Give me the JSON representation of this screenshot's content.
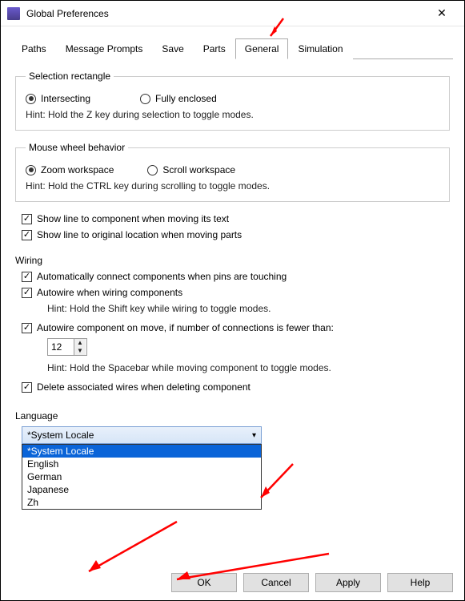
{
  "window": {
    "title": "Global Preferences"
  },
  "tabs": [
    "Paths",
    "Message Prompts",
    "Save",
    "Parts",
    "General",
    "Simulation"
  ],
  "active_tab": 4,
  "selection_rectangle": {
    "legend": "Selection rectangle",
    "opt1": "Intersecting",
    "opt2": "Fully enclosed",
    "selected": 0,
    "hint": "Hint: Hold the Z key during selection to toggle modes."
  },
  "mouse_wheel": {
    "legend": "Mouse wheel behavior",
    "opt1": "Zoom workspace",
    "opt2": "Scroll workspace",
    "selected": 0,
    "hint": "Hint: Hold the CTRL key during scrolling to toggle modes."
  },
  "checks": {
    "line_text": "Show line to component when moving its text",
    "line_text_checked": true,
    "line_loc": "Show line to original location when moving parts",
    "line_loc_checked": true
  },
  "wiring": {
    "legend": "Wiring",
    "auto_connect": "Automatically connect components when pins are touching",
    "auto_connect_checked": true,
    "autowire": "Autowire when wiring components",
    "autowire_checked": true,
    "autowire_hint": "Hint: Hold the Shift key while wiring to toggle modes.",
    "autowire_move": "Autowire component on move, if number of connections is fewer than:",
    "autowire_move_checked": true,
    "autowire_move_value": "12",
    "autowire_move_hint": "Hint: Hold the Spacebar while moving component to toggle modes.",
    "delete_wires": "Delete associated wires when deleting component",
    "delete_wires_checked": true
  },
  "language": {
    "legend": "Language",
    "selected": "*System Locale",
    "options": [
      "*System Locale",
      "English",
      "German",
      "Japanese",
      "Zh"
    ]
  },
  "buttons": {
    "ok": "OK",
    "cancel": "Cancel",
    "apply": "Apply",
    "help": "Help"
  }
}
